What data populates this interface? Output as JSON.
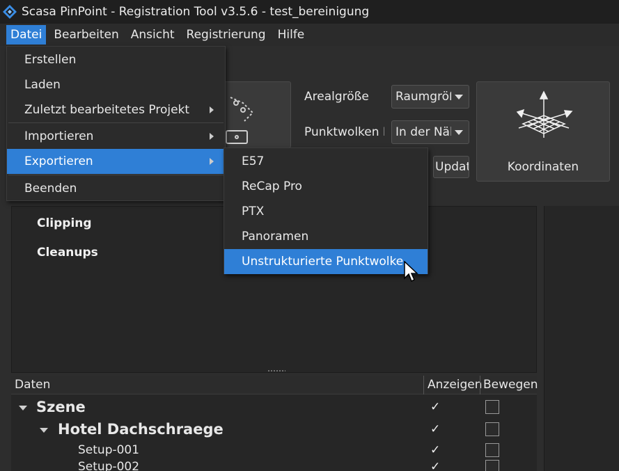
{
  "window": {
    "title": "Scasa PinPoint - Registration Tool v3.5.6 - test_bereinigung"
  },
  "menubar": {
    "items": [
      {
        "label": "Datei",
        "active": true
      },
      {
        "label": "Bearbeiten",
        "active": false
      },
      {
        "label": "Ansicht",
        "active": false
      },
      {
        "label": "Registrierung",
        "active": false
      },
      {
        "label": "Hilfe",
        "active": false
      }
    ]
  },
  "datei_menu": {
    "items": [
      {
        "label": "Erstellen",
        "submenu": false
      },
      {
        "label": "Laden",
        "submenu": false
      },
      {
        "label": "Zuletzt bearbeitetes Projekt",
        "submenu": true
      },
      {
        "label": "Importieren",
        "submenu": true
      },
      {
        "label": "Exportieren",
        "submenu": true,
        "active": true
      },
      {
        "label": "Beenden",
        "submenu": false
      }
    ]
  },
  "export_submenu": {
    "items": [
      {
        "label": "E57"
      },
      {
        "label": "ReCap Pro"
      },
      {
        "label": "PTX"
      },
      {
        "label": "Panoramen"
      },
      {
        "label": "Unstrukturierte Punktwolke",
        "active": true
      }
    ]
  },
  "toolbar": {
    "areal_label": "Arealgröße",
    "areal_value": "Raumgröße",
    "punktwolken_label": "Punktwolken D",
    "punktwolken_value": "In der Nähe",
    "update_label": "Update",
    "koordinaten_label": "Koordinaten"
  },
  "panel": {
    "clipping_label": "Clipping",
    "cleanups_label": "Cleanups"
  },
  "tree": {
    "headers": {
      "daten": "Daten",
      "anzeigen": "Anzeigen",
      "bewegen": "Bewegen"
    },
    "rows": [
      {
        "label": "Szene",
        "anzeigen": "✓",
        "bewegen": false
      },
      {
        "label": "Hotel Dachschraege",
        "anzeigen": "✓",
        "bewegen": false
      },
      {
        "label": "Setup-001",
        "anzeigen": "✓",
        "bewegen": false
      },
      {
        "label": "Setup-002",
        "anzeigen": "✓",
        "bewegen": false
      }
    ]
  },
  "colors": {
    "accent": "#2f7fd6",
    "background": "#2d2d2d",
    "titlebar": "#1f1f1f"
  },
  "icons": [
    "app-logo-icon",
    "chevron-right-icon",
    "dropdown-arrow-icon",
    "coordinate-grid-icon",
    "mouse-pointer-icon"
  ]
}
